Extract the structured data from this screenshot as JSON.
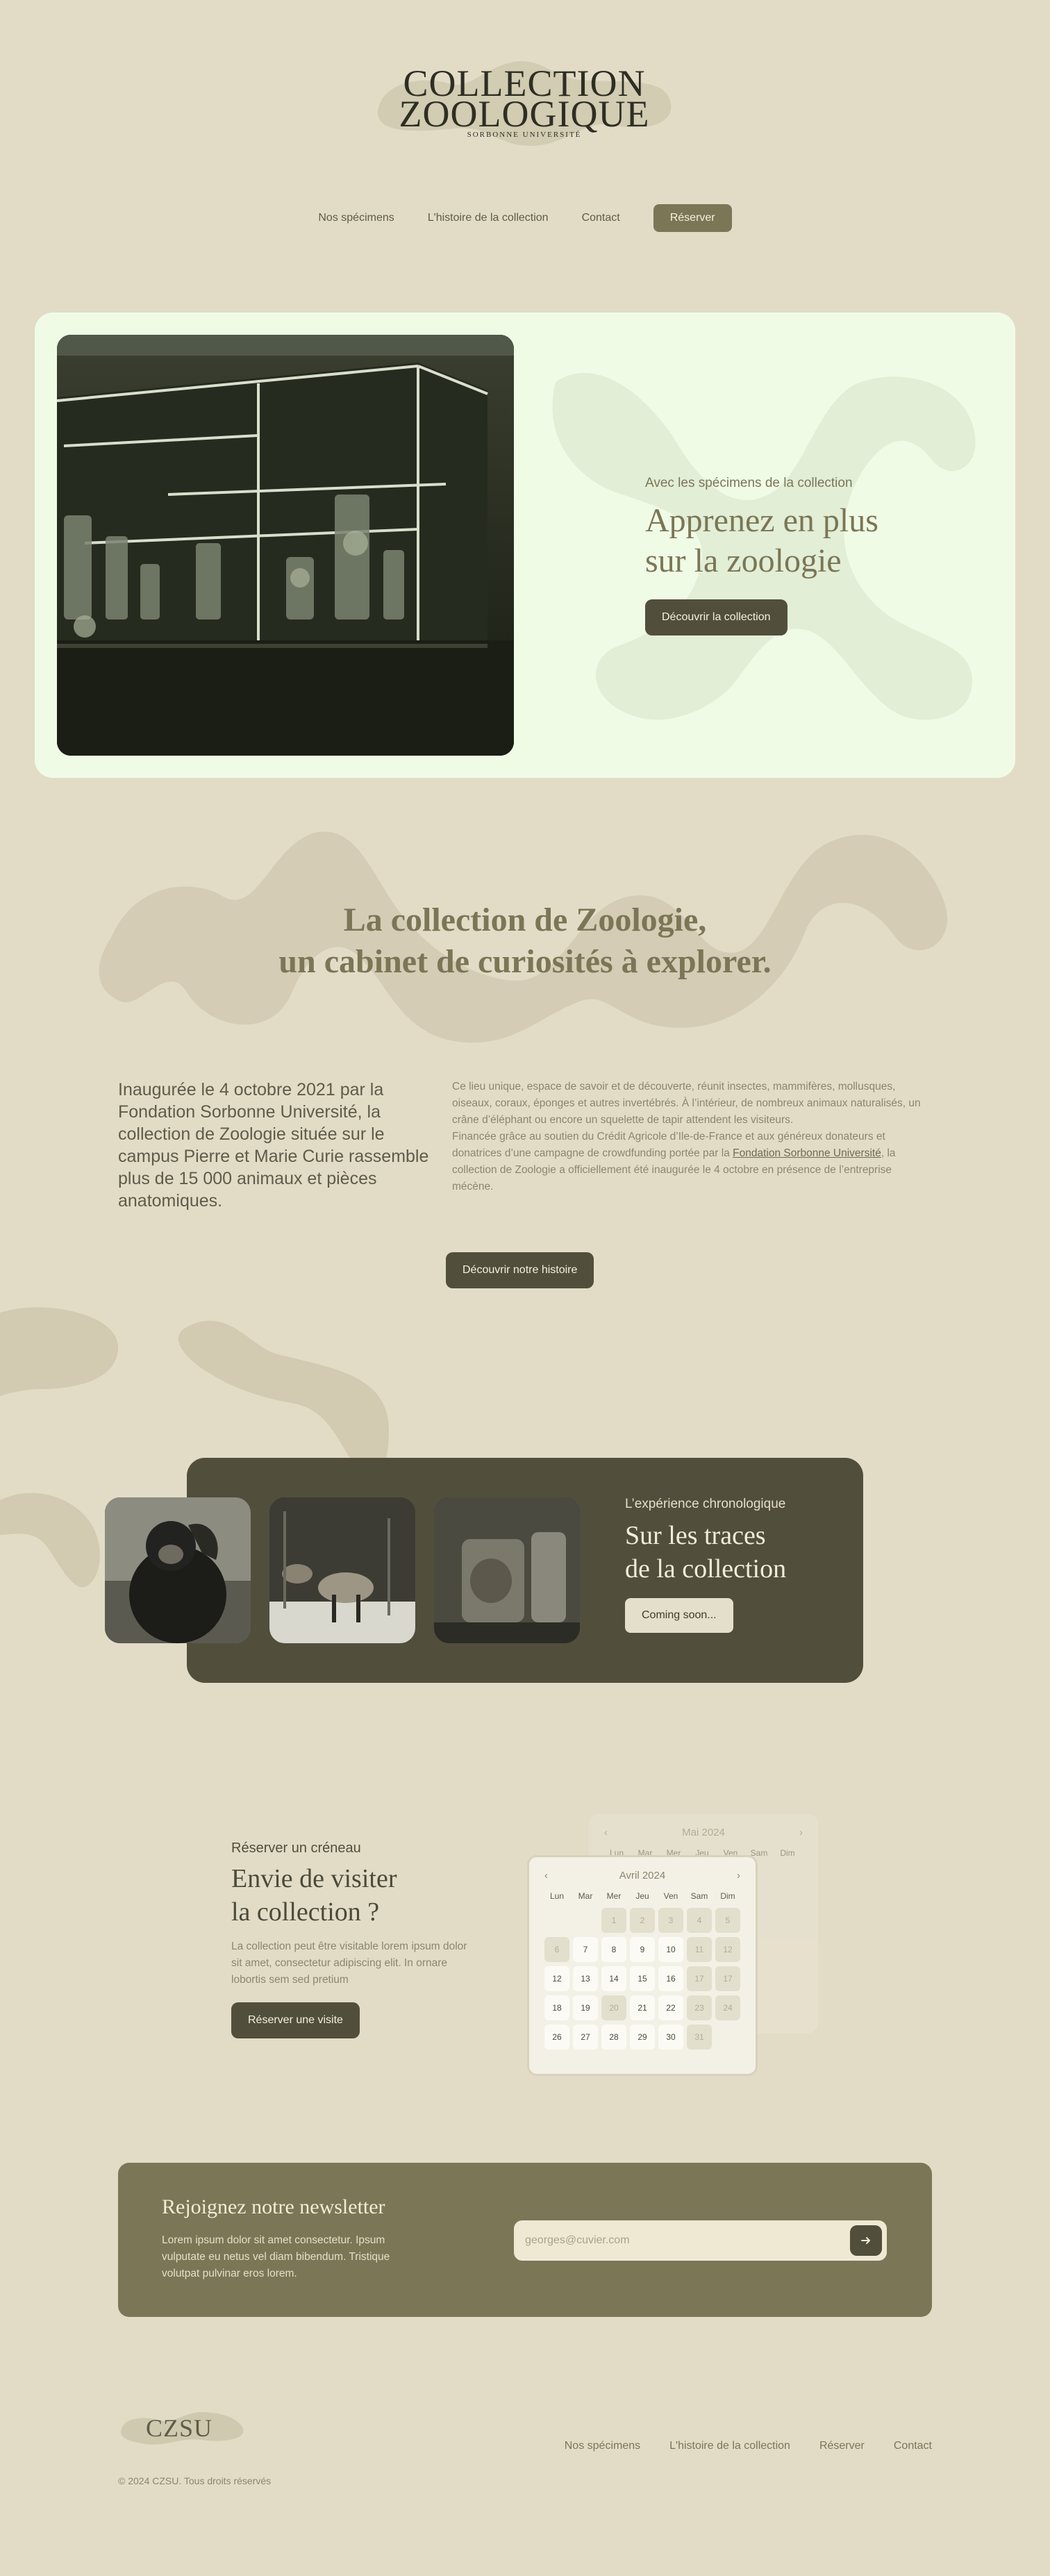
{
  "brand": {
    "title_line1": "COLLECTION",
    "title_line2": "ZOOLOGIQUE",
    "subtitle": "SORBONNE UNIVERSITÉ",
    "footer_logo": "CZSU"
  },
  "nav": {
    "items": [
      "Nos spécimens",
      "L'histoire de la collection",
      "Contact"
    ],
    "cta": "Réserver"
  },
  "hero": {
    "eyebrow": "Avec les spécimens de la collection",
    "title_line1": "Apprenez en plus",
    "title_line2": "sur la zoologie",
    "button": "Découvrir la collection"
  },
  "about": {
    "title_line1": "La collection de Zoologie,",
    "title_line2": "un cabinet de curiosités à explorer.",
    "lead": "Inaugurée le 4 octobre 2021 par la Fondation Sorbonne Université, la collection de Zoologie située sur le campus Pierre et Marie Curie rassemble plus de 15 000 animaux et pièces anatomiques.",
    "body_p1": "Ce lieu unique, espace de savoir et de découverte, réunit insectes, mammifères, mollusques, oiseaux, coraux, éponges et autres invertébrés. À l’intérieur, de nombreux animaux naturalisés, un crâne d’éléphant ou encore un squelette de tapir attendent les visiteurs.",
    "body_p2_before": "Financée grâce au soutien du Crédit Agricole d’Ile-de-France et aux généreux donateurs et donatrices d’une campagne de crowdfunding portée par la ",
    "body_p2_link": "Fondation Sorbonne Université",
    "body_p2_after": ", la collection de Zoologie a officiellement été inaugurée le 4 octobre en présence de l’entreprise mécène.",
    "button": "Découvrir notre histoire"
  },
  "chrono": {
    "eyebrow": "L’expérience chronologique",
    "title_line1": "Sur les traces",
    "title_line2": "de la collection",
    "button": "Coming soon..."
  },
  "reserve": {
    "eyebrow": "Réserver un créneau",
    "title_line1": "Envie de visiter",
    "title_line2": "la collection ?",
    "text": "La collection peut être visitable lorem ipsum dolor sit amet, consectetur adipiscing elit. In ornare lobortis sem sed pretium",
    "button": "Réserver une visite"
  },
  "calendar_front": {
    "month": "Avril 2024",
    "prev": "‹",
    "next": "›",
    "weekdays": [
      "Lun",
      "Mar",
      "Mer",
      "Jeu",
      "Ven",
      "Sam",
      "Dim"
    ],
    "cells": [
      {
        "d": "",
        "s": "empty"
      },
      {
        "d": "",
        "s": "empty"
      },
      {
        "d": "1",
        "s": "dim"
      },
      {
        "d": "2",
        "s": "dim"
      },
      {
        "d": "3",
        "s": "dim"
      },
      {
        "d": "4",
        "s": "dim"
      },
      {
        "d": "5",
        "s": "dim"
      },
      {
        "d": "6",
        "s": "dim"
      },
      {
        "d": "7",
        "s": ""
      },
      {
        "d": "8",
        "s": ""
      },
      {
        "d": "9",
        "s": ""
      },
      {
        "d": "10",
        "s": ""
      },
      {
        "d": "11",
        "s": "dim"
      },
      {
        "d": "12",
        "s": "dim"
      },
      {
        "d": "12",
        "s": ""
      },
      {
        "d": "13",
        "s": ""
      },
      {
        "d": "14",
        "s": ""
      },
      {
        "d": "15",
        "s": ""
      },
      {
        "d": "16",
        "s": ""
      },
      {
        "d": "17",
        "s": "dim"
      },
      {
        "d": "17",
        "s": "dim"
      },
      {
        "d": "18",
        "s": ""
      },
      {
        "d": "19",
        "s": ""
      },
      {
        "d": "20",
        "s": "dim"
      },
      {
        "d": "21",
        "s": ""
      },
      {
        "d": "22",
        "s": ""
      },
      {
        "d": "23",
        "s": "dim"
      },
      {
        "d": "24",
        "s": "dim"
      },
      {
        "d": "26",
        "s": ""
      },
      {
        "d": "27",
        "s": ""
      },
      {
        "d": "28",
        "s": ""
      },
      {
        "d": "29",
        "s": ""
      },
      {
        "d": "30",
        "s": ""
      },
      {
        "d": "31",
        "s": "dim"
      },
      {
        "d": "",
        "s": "empty"
      }
    ]
  },
  "calendar_back": {
    "month": "Mai 2024",
    "prev": "‹",
    "next": "›",
    "weekdays": [
      "Lun",
      "Mar",
      "Mer",
      "Jeu",
      "Ven",
      "Sam",
      "Dim"
    ]
  },
  "newsletter": {
    "title": "Rejoignez notre newsletter",
    "text": "Lorem ipsum dolor sit amet consectetur. Ipsum vulputate eu netus vel diam bibendum. Tristique volutpat pulvinar eros lorem.",
    "placeholder": "georges@cuvier.com",
    "submit_icon": "arrow-right-icon"
  },
  "footer": {
    "links": [
      "Nos spécimens",
      "L'histoire de la collection",
      "Réserver",
      "Contact"
    ],
    "copyright": "© 2024 CZSU. Tous droits réservés"
  },
  "colors": {
    "background": "#e2dcc7",
    "hero_card": "#f0fbe6",
    "dark_olive": "#514e3c",
    "olive": "#7b7656"
  }
}
